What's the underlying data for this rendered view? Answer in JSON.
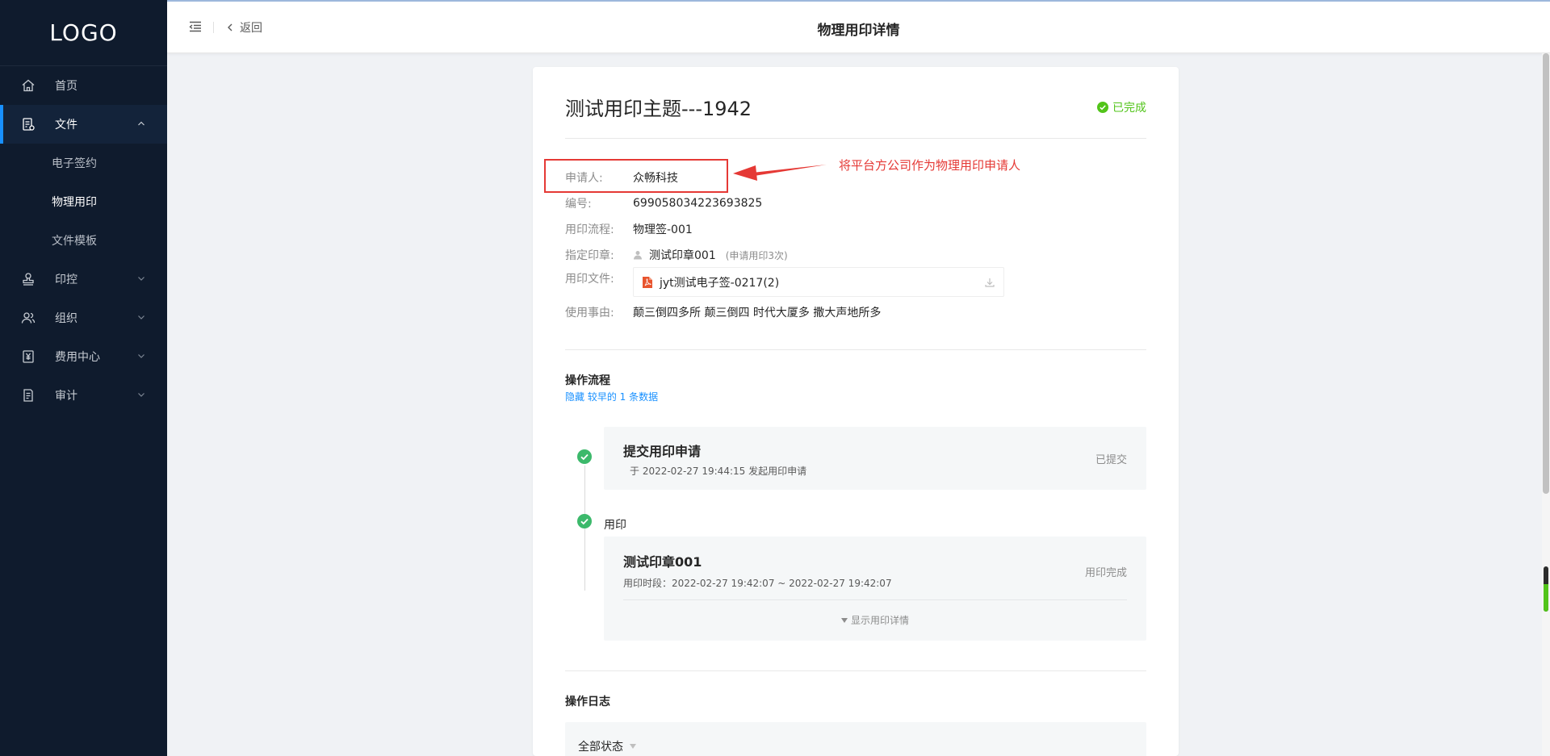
{
  "sidebar": {
    "logo": "LOGO",
    "items": [
      {
        "label": "首页",
        "icon": "home-icon"
      },
      {
        "label": "文件",
        "icon": "file-icon",
        "expanded": true,
        "children": [
          {
            "label": "电子签约"
          },
          {
            "label": "物理用印",
            "current": true
          },
          {
            "label": "文件模板"
          }
        ]
      },
      {
        "label": "印控",
        "icon": "stamp-icon"
      },
      {
        "label": "组织",
        "icon": "org-icon"
      },
      {
        "label": "费用中心",
        "icon": "yen-icon"
      },
      {
        "label": "审计",
        "icon": "audit-icon"
      }
    ]
  },
  "header": {
    "back_label": "返回",
    "title": "物理用印详情"
  },
  "detail": {
    "title": "测试用印主题---1942",
    "status": "已完成",
    "status_color": "#52c41a",
    "applicant": {
      "label": "申请人:",
      "value": "众畅科技"
    },
    "number": {
      "label": "编号:",
      "value": "699058034223693825"
    },
    "process": {
      "label": "用印流程:",
      "value": "物理签-001"
    },
    "seal": {
      "label": "指定印章:",
      "value": "测试印章001",
      "note": "(申请用印3次)"
    },
    "file": {
      "label": "用印文件:",
      "value": "jyt测试电子签-0217(2)"
    },
    "reason": {
      "label": "使用事由:",
      "value": "颠三倒四多所 颠三倒四 时代大厦多 撒大声地所多"
    }
  },
  "annotation": {
    "text": "将平台方公司作为物理用印申请人",
    "color": "#e53935"
  },
  "flow": {
    "title": "操作流程",
    "hide_link": "隐藏 较早的 1 条数据",
    "step1": {
      "title": "提交用印申请",
      "sub": "于 2022-02-27 19:44:15 发起用印申请",
      "status": "已提交"
    },
    "step2": {
      "label": "用印",
      "seal_name": "测试印章001",
      "period": "用印时段：2022-02-27 19:42:07 ~ 2022-02-27 19:42:07",
      "status": "用印完成",
      "toggle": "显示用印详情"
    }
  },
  "log": {
    "title": "操作日志",
    "filter": "全部状态"
  }
}
